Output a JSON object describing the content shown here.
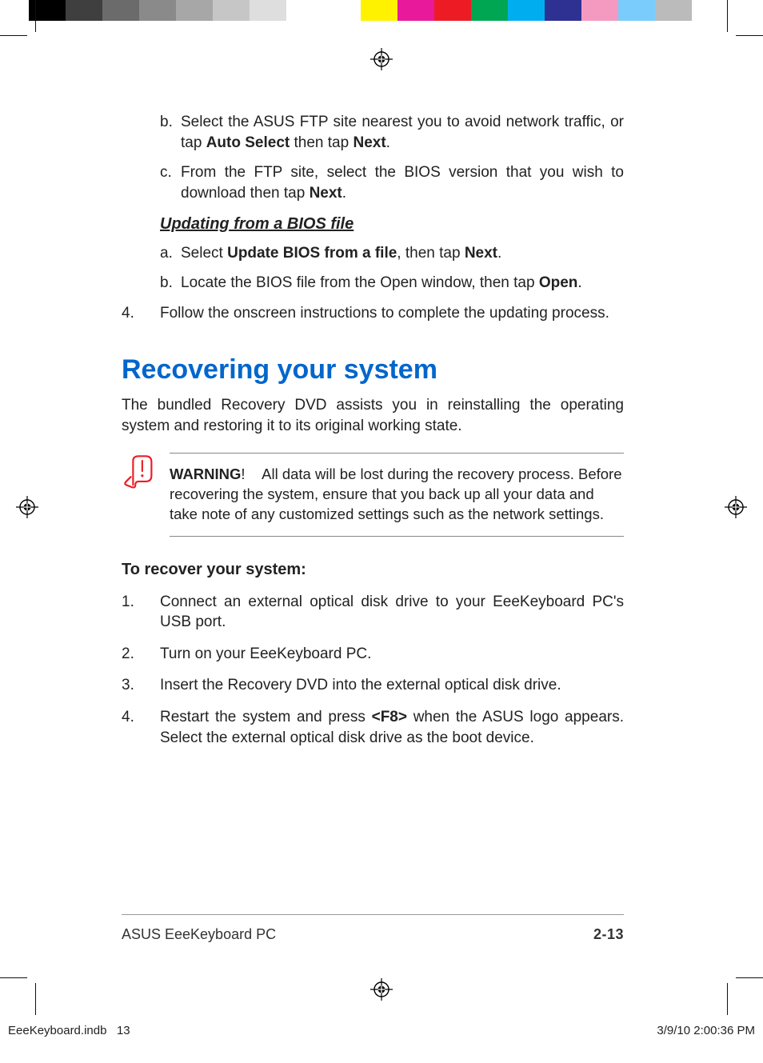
{
  "sub_b": {
    "marker": "b.",
    "pre": "Select the ASUS FTP site nearest you to avoid network traffic, or tap ",
    "bold1": "Auto Select",
    "mid": " then tap ",
    "bold2": "Next",
    "post": "."
  },
  "sub_c": {
    "marker": "c.",
    "pre": "From the FTP site, select the BIOS version that you wish to download then tap ",
    "bold1": "Next",
    "post": "."
  },
  "subheading": "Updating from a BIOS file",
  "sub_a2": {
    "marker": "a.",
    "pre": "Select ",
    "bold1": "Update BIOS from a file",
    "mid": ", then tap ",
    "bold2": "Next",
    "post": "."
  },
  "sub_b2": {
    "marker": "b.",
    "pre": "Locate the BIOS file from the Open window, then tap ",
    "bold1": "Open",
    "post": "."
  },
  "item4": {
    "marker": "4.",
    "text": "Follow the onscreen instructions to complete the updating process."
  },
  "section_title": "Recovering your system",
  "intro": "The bundled Recovery DVD assists you in reinstalling the operating system and restoring it to its original working state.",
  "warning": {
    "label": "WARNING",
    "excl": "!",
    "text": "All data will be lost during the recovery process. Before recovering the system, ensure that you back up all your data and take note of any customized settings such as the network settings."
  },
  "subhead2": "To recover your system:",
  "steps": {
    "s1": {
      "marker": "1.",
      "text": "Connect an external optical disk drive to your EeeKeyboard PC's USB port."
    },
    "s2": {
      "marker": "2.",
      "text": "Turn on your EeeKeyboard PC."
    },
    "s3": {
      "marker": "3.",
      "text": "Insert the Recovery DVD into the external optical disk drive."
    },
    "s4": {
      "marker": "4.",
      "pre": "Restart the system and press ",
      "bold": "<F8>",
      "post": " when the ASUS logo appears. Select the external optical disk drive as the boot device."
    }
  },
  "footer": {
    "left": "ASUS EeeKeyboard PC",
    "right": "2-13"
  },
  "slug": {
    "file": "EeeKeyboard.indb",
    "page": "13",
    "stamp": "3/9/10   2:00:36 PM"
  }
}
